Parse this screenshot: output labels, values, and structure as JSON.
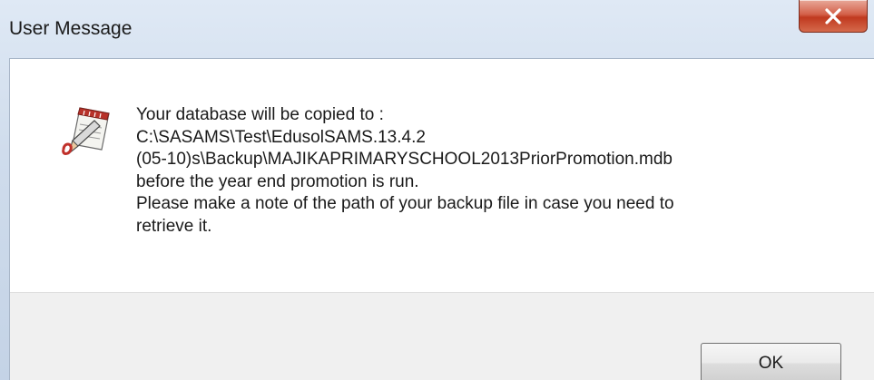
{
  "window": {
    "title": "User Message"
  },
  "message": {
    "icon": "notepad-pencil-icon",
    "lines": [
      "Your database will be copied to :",
      "C:\\SASAMS\\Test\\EdusolSAMS.13.4.2",
      "(05-10)s\\Backup\\MAJIKAPRIMARYSCHOOL2013PriorPromotion.mdb",
      "before the year end promotion is run.",
      "Please make a note of the path of your backup file in case you need to",
      "retrieve it."
    ]
  },
  "buttons": {
    "ok_label": "OK"
  },
  "colors": {
    "close_button": "#c8452a",
    "client_background": "#ffffff",
    "footer_background": "#f0f0f0",
    "frame": "#cfdcec"
  }
}
